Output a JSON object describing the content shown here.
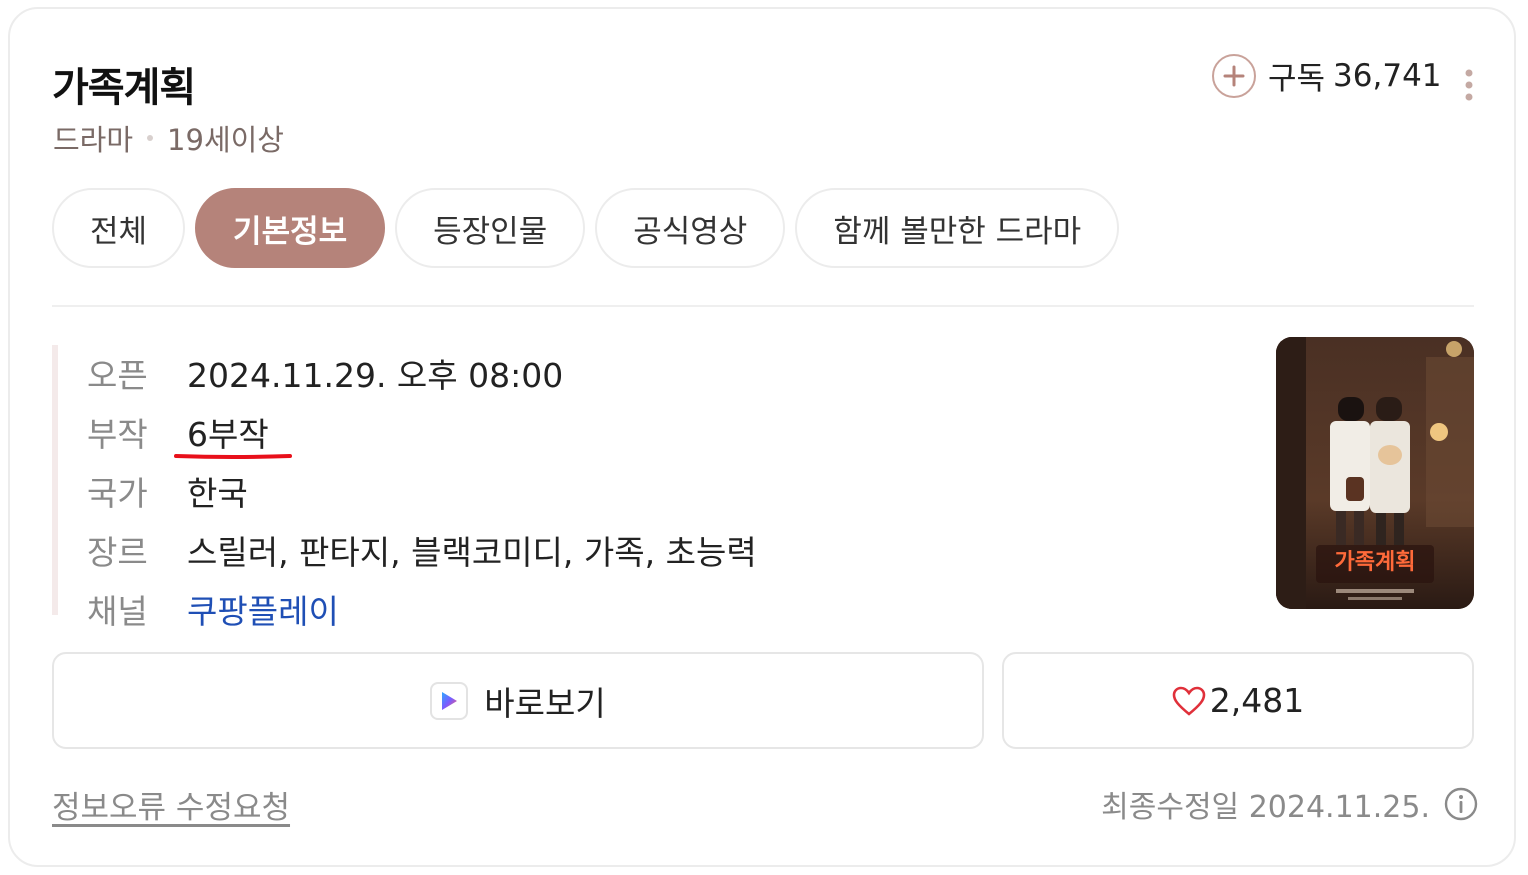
{
  "title": "가족계획",
  "meta": {
    "genre": "드라마",
    "rating": "19세이상"
  },
  "subscribe": {
    "label": "구독",
    "count": "36,741"
  },
  "tabs": [
    {
      "label": "전체",
      "active": false
    },
    {
      "label": "기본정보",
      "active": true
    },
    {
      "label": "등장인물",
      "active": false
    },
    {
      "label": "공식영상",
      "active": false
    },
    {
      "label": "함께 볼만한 드라마",
      "active": false
    }
  ],
  "info": [
    {
      "label": "오픈",
      "value": "2024.11.29. 오후 08:00"
    },
    {
      "label": "부작",
      "value": "6부작"
    },
    {
      "label": "국가",
      "value": "한국"
    },
    {
      "label": "장르",
      "value": "스릴러, 판타지, 블랙코미디, 가족, 초능력"
    },
    {
      "label": "채널",
      "value": "쿠팡플레이"
    }
  ],
  "poster": {
    "title_text": "가족계획"
  },
  "actions": {
    "watch_label": "바로보기",
    "like_count": "2,481"
  },
  "footer": {
    "report_label": "정보오류 수정요청",
    "modified_label": "최종수정일 2024.11.25."
  },
  "colors": {
    "accent": "#b5837a",
    "link": "#1f4fb5",
    "highlight_underline": "#e8101a",
    "heart": "#e0303a"
  }
}
